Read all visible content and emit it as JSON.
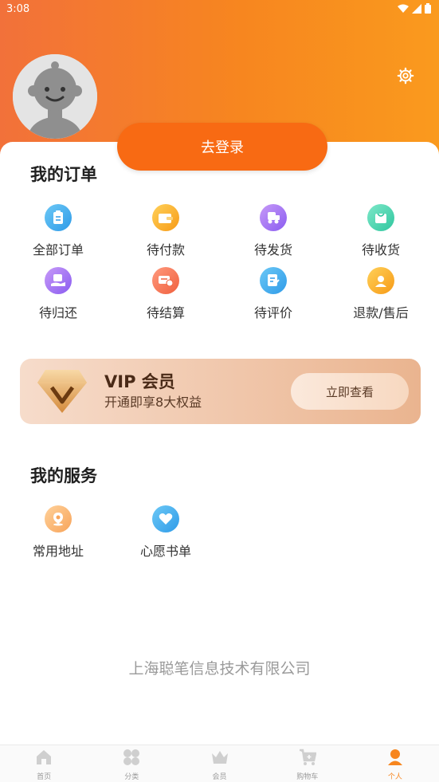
{
  "status": {
    "time": "3:08"
  },
  "header": {
    "login_label": "去登录"
  },
  "orders": {
    "title": "我的订单",
    "items": [
      {
        "label": "全部订单",
        "icon": "clipboard-icon"
      },
      {
        "label": "待付款",
        "icon": "wallet-icon"
      },
      {
        "label": "待发货",
        "icon": "delivery-icon"
      },
      {
        "label": "待收货",
        "icon": "package-icon"
      },
      {
        "label": "待归还",
        "icon": "return-icon"
      },
      {
        "label": "待结算",
        "icon": "settle-icon"
      },
      {
        "label": "待评价",
        "icon": "review-icon"
      },
      {
        "label": "退款/售后",
        "icon": "after-sale-icon"
      }
    ]
  },
  "vip": {
    "title": "VIP 会员",
    "subtitle": "开通即享8大权益",
    "button": "立即查看"
  },
  "services": {
    "title": "我的服务",
    "items": [
      {
        "label": "常用地址",
        "icon": "location-icon"
      },
      {
        "label": "心愿书单",
        "icon": "heart-icon"
      }
    ]
  },
  "footer": {
    "company": "上海聪笔信息技术有限公司"
  },
  "tabbar": {
    "items": [
      {
        "label": "首页",
        "icon": "home-icon"
      },
      {
        "label": "分类",
        "icon": "category-icon"
      },
      {
        "label": "会员",
        "icon": "crown-icon"
      },
      {
        "label": "购物车",
        "icon": "cart-icon"
      },
      {
        "label": "个人",
        "icon": "person-icon"
      }
    ],
    "active": "个人"
  },
  "colors": {
    "accent": "#f86a13",
    "header_start": "#f2713a",
    "header_end": "#fa9a1e"
  }
}
